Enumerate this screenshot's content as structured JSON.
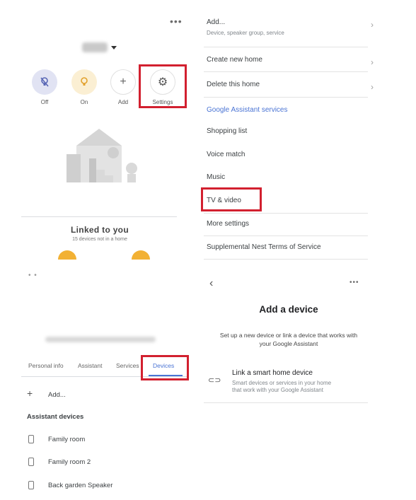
{
  "panel1": {
    "menu_dots": "•••",
    "quick_actions": [
      {
        "label": "Off",
        "icon": "bulb-off-icon"
      },
      {
        "label": "On",
        "icon": "bulb-on-icon"
      },
      {
        "label": "Add",
        "icon": "plus-icon"
      },
      {
        "label": "Settings",
        "icon": "gear-icon"
      }
    ],
    "linked_title": "Linked to you",
    "linked_subtitle": "15 devices not in a home"
  },
  "panel2": {
    "add_label": "Add...",
    "add_sub": "Device, speaker group, service",
    "create_home": "Create new home",
    "delete_home": "Delete this home",
    "section_title": "Google Assistant services",
    "items": [
      "Shopping list",
      "Voice match",
      "Music",
      "TV & video",
      "More settings",
      "Supplemental Nest Terms of Service"
    ]
  },
  "panel3": {
    "tabs": [
      "Personal info",
      "Assistant",
      "Services",
      "Devices"
    ],
    "add_label": "Add...",
    "section_title": "Assistant devices",
    "devices": [
      "Family room",
      "Family room 2",
      "Back garden Speaker"
    ]
  },
  "panel4": {
    "title": "Add a device",
    "subtitle_line1": "Set up a new device or link a device that works with",
    "subtitle_line2": "your Google Assistant",
    "link_title": "Link a smart home device",
    "link_sub_line1": "Smart devices or services in your home",
    "link_sub_line2": "that work with your Google Assistant"
  },
  "colors": {
    "accent": "#4a74d4",
    "highlight": "#d2202f",
    "sun": "#f2b134"
  }
}
